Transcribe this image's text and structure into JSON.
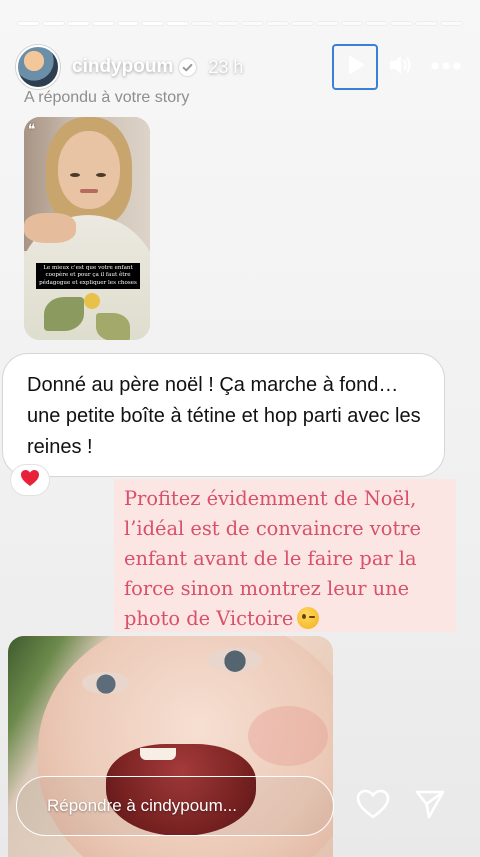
{
  "header": {
    "username": "cindypoum",
    "time": "23 h",
    "verified": true
  },
  "progress": {
    "segments_total": 18,
    "segments_done": 7
  },
  "replied_label": "A répondu à votre story",
  "thumbnail_caption": "Le mieux c'est que votre enfant coopère et pour ça il faut être pédagogue et expliquer les choses",
  "reply_message": "Donné au père noël ! Ça marche à fond… une petite boîte à tétine et hop parti avec les reines !",
  "reaction": "❤️",
  "overlay_text": {
    "line1": "Profitez évidemment de Noël,",
    "line2": "l’idéal est de convaincre votre",
    "line3": "enfant avant de le faire par la",
    "line4": "force sinon montrez leur une",
    "line5": "photo de Victoire"
  },
  "reply_bar": {
    "placeholder": "Répondre à cindypoum..."
  },
  "icons": {
    "play": "play-icon",
    "sound": "volume-icon",
    "more": "more-icon",
    "like": "heart-icon",
    "send": "send-icon"
  },
  "colors": {
    "overlay_text": "#d8506a",
    "overlay_background": "#fbe6e4",
    "focus_outline": "#3b7fd8"
  }
}
